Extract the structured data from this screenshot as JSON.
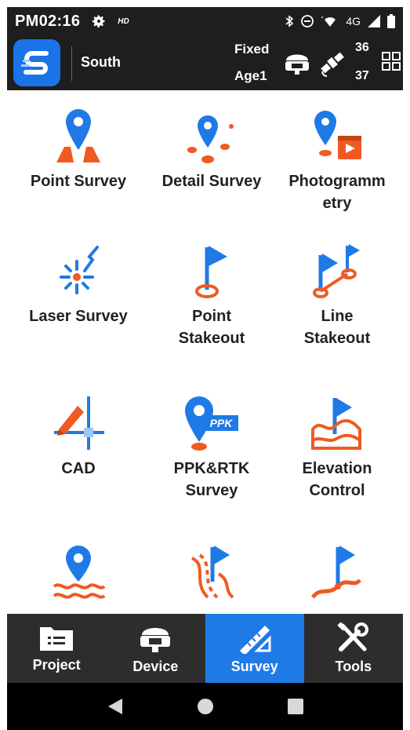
{
  "status_bar": {
    "time": "PM02:16",
    "hd_label": "HD",
    "network_label": "4G"
  },
  "header": {
    "brand": "South",
    "solution_status": "Fixed",
    "age": "Age1",
    "satellites_used": "36",
    "satellites_visible": "37"
  },
  "tiles": [
    {
      "label": "Point Survey",
      "icon": "point-survey-icon"
    },
    {
      "label": "Detail Survey",
      "icon": "detail-survey-icon"
    },
    {
      "label": "Photogramm\netry",
      "icon": "photogrammetry-icon"
    },
    {
      "label": "Laser Survey",
      "icon": "laser-survey-icon"
    },
    {
      "label": "Point\nStakeout",
      "icon": "point-stakeout-icon"
    },
    {
      "label": "Line\nStakeout",
      "icon": "line-stakeout-icon"
    },
    {
      "label": "CAD",
      "icon": "cad-icon"
    },
    {
      "label": "PPK&RTK\nSurvey",
      "icon": "ppk-rtk-icon"
    },
    {
      "label": "Elevation\nControl",
      "icon": "elevation-control-icon"
    },
    {
      "label": "",
      "icon": "water-survey-icon"
    },
    {
      "label": "",
      "icon": "road-stakeout-icon"
    },
    {
      "label": "",
      "icon": "curve-stakeout-icon"
    }
  ],
  "ppk_badge": "PPK",
  "bottom_nav": [
    {
      "label": "Project",
      "icon": "project-icon"
    },
    {
      "label": "Device",
      "icon": "device-icon"
    },
    {
      "label": "Survey",
      "icon": "survey-icon",
      "active": true
    },
    {
      "label": "Tools",
      "icon": "tools-icon"
    }
  ],
  "colors": {
    "accent_orange": "#f05a22",
    "accent_blue": "#1f7ae6",
    "dark_bar": "#1e1e1e",
    "nav_bar": "#2d2d2d"
  }
}
